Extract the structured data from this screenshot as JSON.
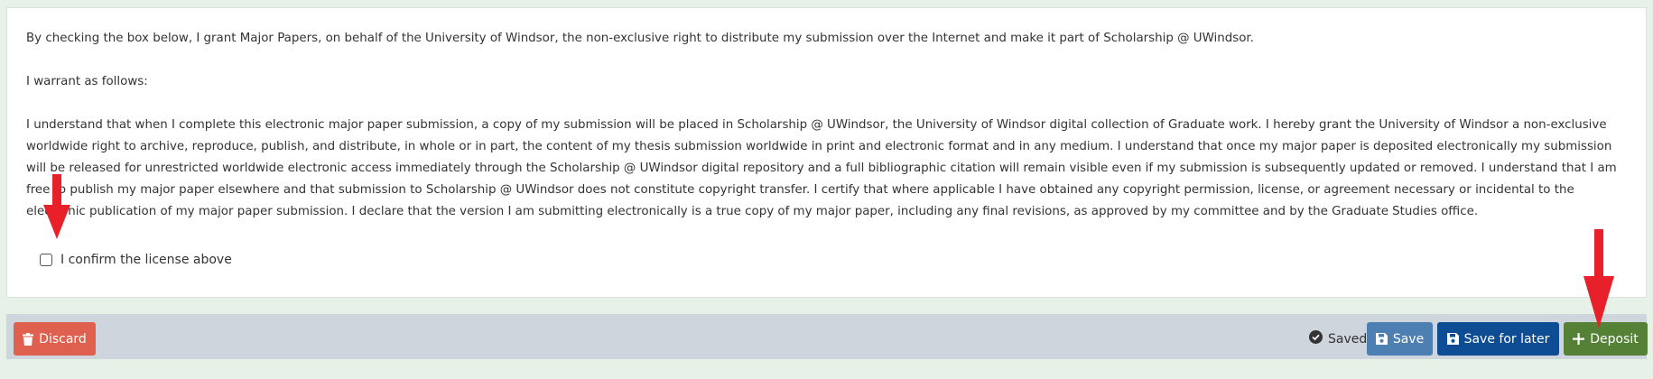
{
  "license": {
    "intro": "By checking the box below, I grant Major Papers, on behalf of the University of Windsor, the non-exclusive right to distribute my submission over the Internet and make it part of Scholarship @ UWindsor.",
    "warrant": "I warrant as follows:",
    "body": "I understand that when I complete this electronic major paper submission, a copy of my submission will be placed in Scholarship @ UWindsor, the University of Windsor digital collection of Graduate work. I hereby grant the University of Windsor a non-exclusive worldwide right to archive, reproduce, publish, and distribute, in whole or in part, the content of my thesis submission worldwide in print and electronic format and in any medium. I understand that once my major paper is deposited electronically my submission will be released for unrestricted worldwide electronic access immediately through the Scholarship @ UWindsor digital repository and a full bibliographic citation will remain visible even if my submission is subsequently updated or removed. I understand that I am free to publish my major paper elsewhere and that submission to Scholarship @ UWindsor does not constitute copyright transfer. I certify that where applicable I have obtained any copyright permission, license, or agreement necessary or incidental to the electronic publication of my major paper submission. I declare that the version I am submitting electronically is a true copy of my major paper, including any final revisions, as approved by my committee and by the Graduate Studies office.",
    "confirm_label": "I confirm the license above",
    "confirmed": false
  },
  "actions": {
    "discard_label": "Discard",
    "saved_label": "Saved",
    "save_label": "Save",
    "save_later_label": "Save for later",
    "deposit_label": "Deposit"
  },
  "icons": {
    "discard": "trash-icon",
    "saved": "check-circle-icon",
    "save": "floppy-disk-icon",
    "save_later": "floppy-disk-icon",
    "deposit": "plus-icon"
  },
  "colors": {
    "discard": "#e0604f",
    "save": "#4e7fb2",
    "save_later": "#0e4c94",
    "deposit": "#548136",
    "annotation_arrow": "#e8202a"
  }
}
